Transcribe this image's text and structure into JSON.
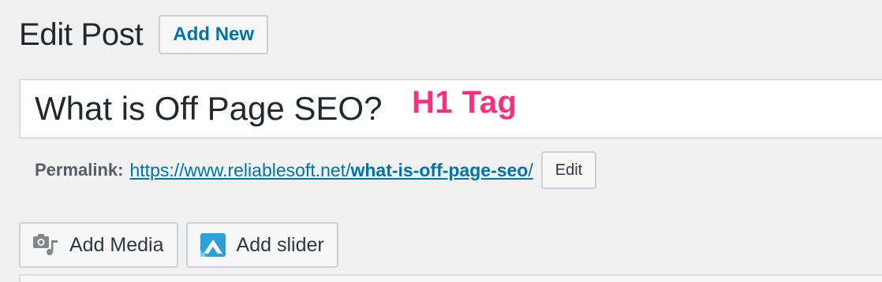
{
  "header": {
    "title": "Edit Post",
    "add_new_label": "Add New"
  },
  "post": {
    "title": "What is Off Page SEO?",
    "annotation": "H1 Tag"
  },
  "permalink": {
    "label": "Permalink:",
    "base_url": "https://www.reliablesoft.net/",
    "slug": "what-is-off-page-seo",
    "trailing": "/",
    "edit_label": "Edit"
  },
  "media_buttons": [
    {
      "label": "Add Media",
      "icon": "add-media-icon"
    },
    {
      "label": "Add slider",
      "icon": "slider-icon"
    }
  ],
  "colors": {
    "link": "#0073aa",
    "annotation": "#ff2f7e",
    "background": "#f1f1f1"
  }
}
